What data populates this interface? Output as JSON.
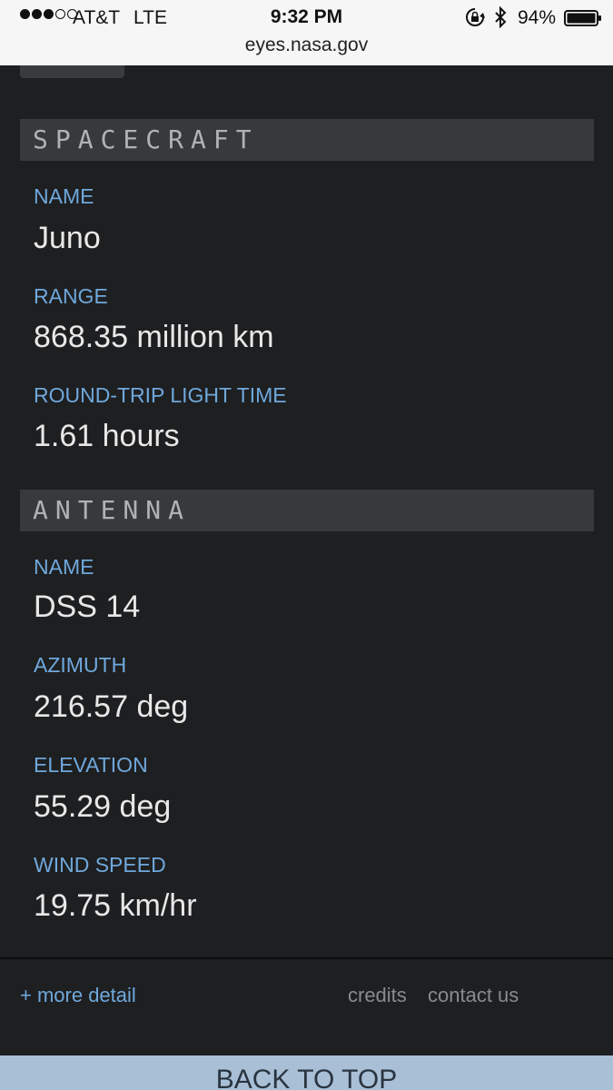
{
  "statusbar": {
    "carrier": "AT&T",
    "network": "LTE",
    "time": "9:32 PM",
    "battery": "94%",
    "url": "eyes.nasa.gov"
  },
  "spacecraft": {
    "title": "SPACECRAFT",
    "name_label": "NAME",
    "name_value": "Juno",
    "range_label": "RANGE",
    "range_value": "868.35 million km",
    "rtlt_label": "ROUND-TRIP LIGHT TIME",
    "rtlt_value": "1.61 hours"
  },
  "antenna": {
    "title": "ANTENNA",
    "name_label": "NAME",
    "name_value": "DSS 14",
    "azimuth_label": "AZIMUTH",
    "azimuth_value": "216.57 deg",
    "elevation_label": "ELEVATION",
    "elevation_value": "55.29 deg",
    "wind_label": "WIND SPEED",
    "wind_value": "19.75 km/hr"
  },
  "footer": {
    "more_detail": "+ more detail",
    "credits": "credits",
    "contact": "contact us",
    "back_to_top": "BACK TO TOP"
  },
  "colors": {
    "background": "#1e1f21",
    "label": "#6fa8dc",
    "value": "#e8e8e8",
    "header_bg": "#38393b"
  }
}
